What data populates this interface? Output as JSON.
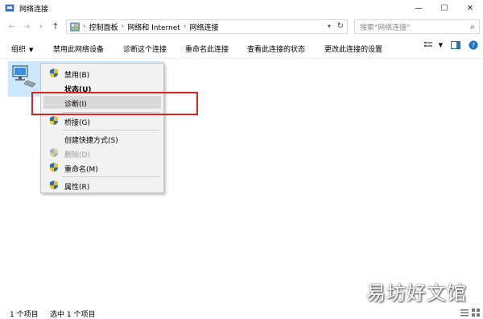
{
  "window": {
    "title": "网络连接",
    "controls": {
      "minimize": "—",
      "maximize": "☐",
      "close": "✕"
    }
  },
  "address": {
    "segments": [
      "控制面板",
      "网络和 Internet",
      "网络连接"
    ],
    "search_placeholder": "搜索\"网络连接\""
  },
  "toolbar": {
    "organize": "组织",
    "items": [
      "禁用此网络设备",
      "诊断这个连接",
      "重命名此连接",
      "查看此连接的状态",
      "更改此连接的设置"
    ]
  },
  "context_menu": {
    "items": [
      {
        "label": "禁用(B)",
        "icon": "shield-icon",
        "state": "normal"
      },
      {
        "label": "状态(U)",
        "icon": "",
        "state": "bold"
      },
      {
        "label": "诊断(I)",
        "icon": "",
        "state": "highlighted"
      },
      {
        "label": "桥接(G)",
        "icon": "shield-icon",
        "state": "normal"
      },
      {
        "label": "创建快捷方式(S)",
        "icon": "",
        "state": "normal"
      },
      {
        "label": "删除(D)",
        "icon": "shield-icon",
        "state": "disabled"
      },
      {
        "label": "重命名(M)",
        "icon": "shield-icon",
        "state": "normal"
      },
      {
        "label": "属性(R)",
        "icon": "shield-icon",
        "state": "normal"
      }
    ]
  },
  "status": {
    "count": "1 个项目",
    "selected": "选中 1 个项目"
  },
  "watermark": "易坊好文馆",
  "colors": {
    "selection": "#cce8ff",
    "highlight_box": "#e0231c",
    "menu_bg": "#f2f2f2"
  }
}
